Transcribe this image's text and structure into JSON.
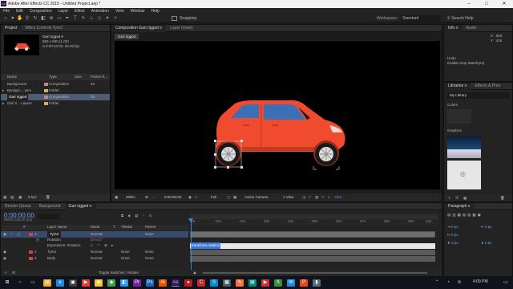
{
  "window": {
    "title": "Adobe After Effects CC 2015 - Untitled Project.aep *",
    "app_icon": "Ae"
  },
  "menu": [
    "File",
    "Edit",
    "Composition",
    "Layer",
    "Effect",
    "Animation",
    "View",
    "Window",
    "Help"
  ],
  "toolbar": {
    "snapping": "Snapping",
    "workspace_label": "Workspace:",
    "workspace_value": "Standard",
    "search": "Search Help"
  },
  "project": {
    "tabs": [
      "Project",
      "Effect Controls Tyre2"
    ],
    "comp_name": "Gari rigged ▾",
    "comp_size": "960 x 500 (1.00)",
    "comp_duration": "Δ 0:00:10:00, 25.00 fps",
    "columns": [
      "Name",
      "Type",
      "Size",
      "Frame R..."
    ],
    "items": [
      {
        "name": "Background",
        "type": "Composition",
        "size": "25",
        "label": "pink"
      },
      {
        "name": "Backgro....yers",
        "type": "Folder",
        "size": "",
        "label": "yellow"
      },
      {
        "name": "Gari rigged",
        "type": "Composition",
        "size": "25",
        "label": "pink"
      },
      {
        "name": "Gari ri... Layers",
        "type": "Folder",
        "size": "",
        "label": "yellow"
      }
    ],
    "bpc": "8 bpc"
  },
  "composition": {
    "tabs": [
      "Composition Gari rigged ≡",
      "Layer (none)"
    ],
    "subtab": "Gari rigged",
    "footer": {
      "zoom": "200%",
      "time": "0:00:00:00",
      "resolution": "Full",
      "camera": "Active Camera",
      "view": "1 View",
      "exposure": "+0.0"
    }
  },
  "info": {
    "tabs": [
      "Info ≡",
      "Audio"
    ],
    "x": "X : 693",
    "y": "Y : 416",
    "undo": "Undo",
    "msg": "Enable Stop Watch(es)"
  },
  "libraries": {
    "tabs": [
      "Libraries ≡",
      "Effects & Pres"
    ],
    "library": "My Library",
    "colors": "Colors",
    "graphics": "Graphics"
  },
  "timeline": {
    "tabs": [
      "Render Queue",
      "Background",
      "Gari rigged ≡"
    ],
    "time": "0:00:00:00",
    "fps": "00000 (25.00 fps)",
    "headers": [
      "#",
      "Layer Name",
      "Mode",
      "T",
      "TrkMat",
      "Parent"
    ],
    "layers": [
      {
        "num": "1",
        "name": "Tyre2",
        "mode": "Normal",
        "trkmat": "",
        "parent": "None"
      },
      {
        "prop": "Rotation",
        "value": "0x+0.0°"
      },
      {
        "prop": "Expression: Rotation"
      },
      {
        "num": "2",
        "name": "Tyre1",
        "mode": "Normal",
        "trkmat": "None",
        "parent": "None"
      },
      {
        "num": "3",
        "name": "Body",
        "mode": "Normal",
        "trkmat": "None",
        "parent": "None"
      }
    ],
    "ruler": [
      "0s",
      "01s",
      "02s",
      "03s",
      "04s",
      "05s",
      "06s",
      "07s",
      "08s",
      "09s",
      "10s"
    ],
    "expression_text": "transform.rotation",
    "toggle_label": "Toggle Switches / Modes"
  },
  "paragraph": {
    "tab": "Paragraph ≡",
    "fields": [
      "0 px",
      "0 px",
      "0 px",
      "0 px",
      "0 px"
    ]
  },
  "taskbar": {
    "time": "4:09 PM"
  },
  "colors": {
    "car_body": "#f04b2f",
    "accent_blue": "#2d8ceb",
    "ae_purple": "#2a1b4a"
  }
}
